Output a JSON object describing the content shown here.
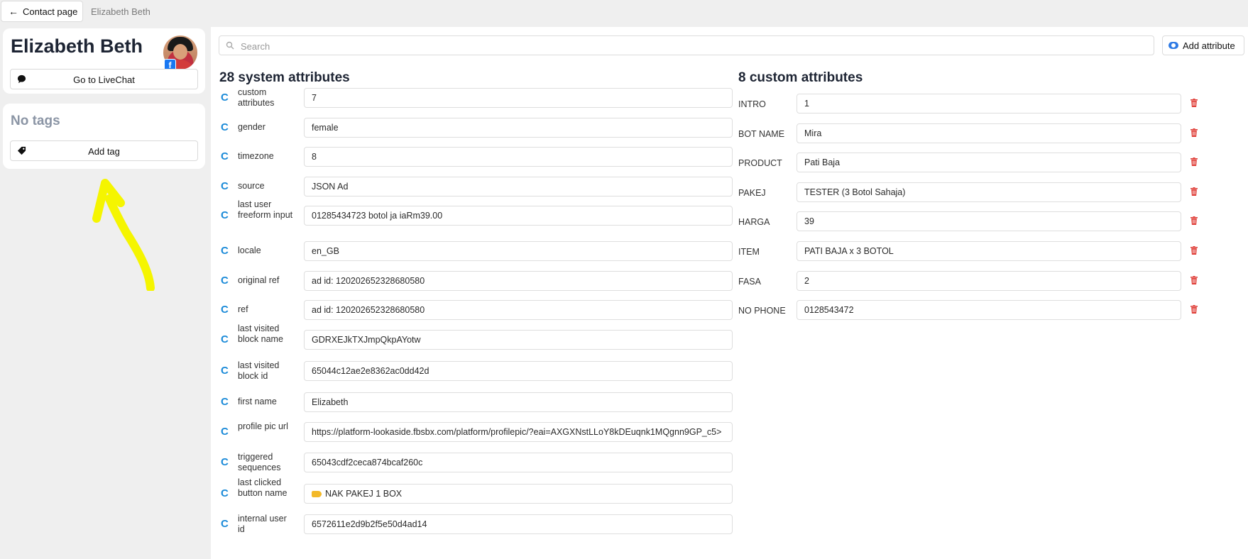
{
  "breadcrumb": {
    "back_label": "Contact page",
    "current": "Elizabeth Beth"
  },
  "profile": {
    "name": "Elizabeth Beth",
    "livechat_label": "Go to LiveChat"
  },
  "tags": {
    "empty_label": "No tags",
    "add_label": "Add tag"
  },
  "search": {
    "placeholder": "Search"
  },
  "add_attribute_label": "Add attribute",
  "system": {
    "title": "28 system attributes",
    "rows": [
      {
        "label": "custom attributes",
        "value": "7"
      },
      {
        "label": "gender",
        "value": "female"
      },
      {
        "label": "timezone",
        "value": "8"
      },
      {
        "label": "source",
        "value": "JSON Ad"
      },
      {
        "label": "last user freeform input",
        "value": "01285434723 botol ja iaRm39.00"
      },
      {
        "label": "locale",
        "value": "en_GB"
      },
      {
        "label": "original ref",
        "value": "ad id: 120202652328680580"
      },
      {
        "label": "ref",
        "value": "ad id: 120202652328680580"
      },
      {
        "label": "last visited block name",
        "value": "GDRXEJkTXJmpQkpAYotw"
      },
      {
        "label": "last visited block id",
        "value": "65044c12ae2e8362ac0dd42d"
      },
      {
        "label": "first name",
        "value": "Elizabeth"
      },
      {
        "label": "profile pic url",
        "value": "https://platform-lookaside.fbsbx.com/platform/profilepic/?eai=AXGXNstLLoY8kDEuqnk1MQgnn9GP_c5>"
      },
      {
        "label": "triggered sequences",
        "value": "65043cdf2ceca874bcaf260c"
      },
      {
        "label": "last clicked button name",
        "value": "NAK PAKEJ 1 BOX"
      },
      {
        "label": "internal user id",
        "value": "6572611e2d9b2f5e50d4ad14"
      }
    ]
  },
  "custom": {
    "title": "8 custom attributes",
    "rows": [
      {
        "label": "INTRO",
        "value": "1"
      },
      {
        "label": "BOT NAME",
        "value": "Mira"
      },
      {
        "label": "PRODUCT",
        "value": "Pati Baja"
      },
      {
        "label": "PAKEJ",
        "value": "TESTER (3 Botol Sahaja)"
      },
      {
        "label": "HARGA",
        "value": "39"
      },
      {
        "label": "ITEM",
        "value": "PATI BAJA x 3 BOTOL"
      },
      {
        "label": "FASA",
        "value": "2"
      },
      {
        "label": "NO PHONE",
        "value": "0128543472"
      }
    ]
  },
  "colors": {
    "accent": "#1a8ad8",
    "delete": "#e0403a",
    "annotation": "#f5f500"
  },
  "icons": {
    "back": "arrow-left-icon",
    "chat": "chat-bubble-icon",
    "tag": "tag-icon",
    "search": "search-icon",
    "attr": "eye-icon",
    "system": "c-refresh-icon",
    "delete": "trash-icon"
  }
}
